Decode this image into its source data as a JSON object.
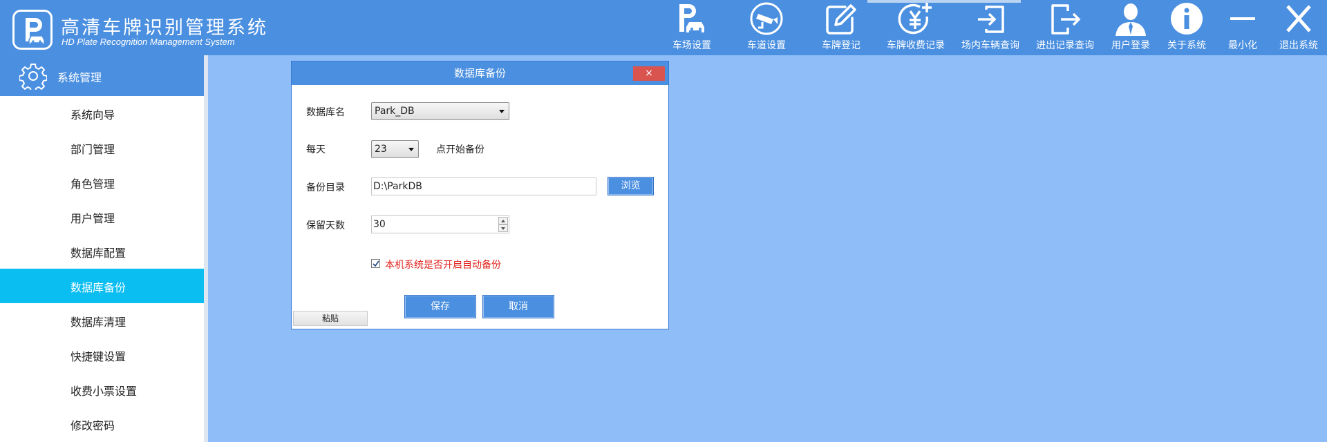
{
  "app": {
    "title": "高清车牌识别管理系统",
    "subtitle": "HD Plate Recognition Management System",
    "logo_letter": "P"
  },
  "toolbar": [
    {
      "label": "车场设置",
      "icon": "parking-car-icon"
    },
    {
      "label": "车道设置",
      "icon": "camera-icon"
    },
    {
      "label": "车牌登记",
      "icon": "edit-icon"
    },
    {
      "label": "车牌收费记录",
      "icon": "yuan-add-icon"
    },
    {
      "label": "场内车辆查询",
      "icon": "login-icon"
    },
    {
      "label": "进出记录查询",
      "icon": "logout-icon"
    },
    {
      "label": "用户登录",
      "icon": "user-icon"
    },
    {
      "label": "关于系统",
      "icon": "info-icon"
    },
    {
      "label": "最小化",
      "icon": "minimize-icon"
    },
    {
      "label": "退出系统",
      "icon": "close-icon"
    }
  ],
  "sidebar": {
    "header": "系统管理",
    "items": [
      {
        "label": "系统向导"
      },
      {
        "label": "部门管理"
      },
      {
        "label": "角色管理"
      },
      {
        "label": "用户管理"
      },
      {
        "label": "数据库配置"
      },
      {
        "label": "数据库备份",
        "active": true
      },
      {
        "label": "数据库清理"
      },
      {
        "label": "快捷键设置"
      },
      {
        "label": "收费小票设置"
      },
      {
        "label": "修改密码"
      }
    ]
  },
  "dialog": {
    "title": "数据库备份",
    "close_label": "×",
    "db_name_label": "数据库名",
    "db_name_value": "Park_DB",
    "daily_label": "每天",
    "hour_value": "23",
    "hour_suffix": "点开始备份",
    "dir_label": "备份目录",
    "dir_value": "D:\\ParkDB",
    "browse_label": "浏览",
    "keep_days_label": "保留天数",
    "keep_days_value": "30",
    "auto_backup_label": "本机系统是否开启自动备份",
    "auto_backup_checked": true,
    "save_label": "保存",
    "cancel_label": "取消",
    "paste_label": "粘贴"
  },
  "colors": {
    "header": "#4a8fe0",
    "background": "#8fbdf7",
    "sidebar_active": "#0bbef2",
    "warning_text": "#e0201b"
  }
}
